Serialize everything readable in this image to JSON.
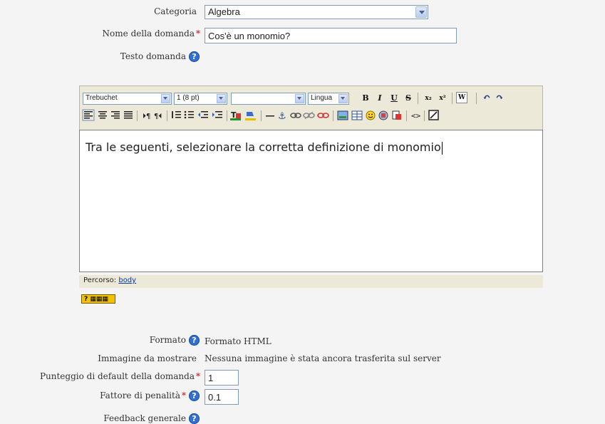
{
  "form": {
    "categoria_label": "Categoria",
    "categoria_value": "Algebra",
    "nome_label": "Nome della domanda",
    "nome_value": "Cos'è un monomio?",
    "testo_label": "Testo domanda",
    "formato_label": "Formato",
    "formato_value": "Formato HTML",
    "immagine_label": "Immagine da mostrare",
    "immagine_value": "Nessuna immagine è stata ancora trasferita sul server",
    "punteggio_label": "Punteggio di default della domanda",
    "punteggio_value": "1",
    "penalita_label": "Fattore di penalità",
    "penalita_value": "0.1",
    "feedback_label": "Feedback generale",
    "required_mark": "*",
    "help_glyph": "?"
  },
  "editor": {
    "font_family": "Trebuchet",
    "font_size": "1 (8 pt)",
    "style_value": "",
    "language": "Lingua",
    "content_text": "Tra le seguenti, selezionare la corretta definizione di monomio",
    "path_label": "Percorso:",
    "path_link": "body",
    "keyboard_badge": "?"
  },
  "toolbar_row1": [
    {
      "name": "bold-button",
      "glyph": "B"
    },
    {
      "name": "italic-button",
      "glyph": "I"
    },
    {
      "name": "underline-button",
      "glyph": "U"
    },
    {
      "name": "strikethrough-button",
      "glyph": "S"
    },
    {
      "name": "subscript-button",
      "glyph": "x₂"
    },
    {
      "name": "superscript-button",
      "glyph": "x²"
    },
    {
      "name": "paste-word-button",
      "glyph": "W"
    },
    {
      "name": "undo-button",
      "glyph": "↶"
    },
    {
      "name": "redo-button",
      "glyph": "↷"
    }
  ],
  "colors": {
    "toolbar_bg": "#ece9d8",
    "help_blue": "#2f6fd6",
    "required_red": "#dd0000"
  }
}
